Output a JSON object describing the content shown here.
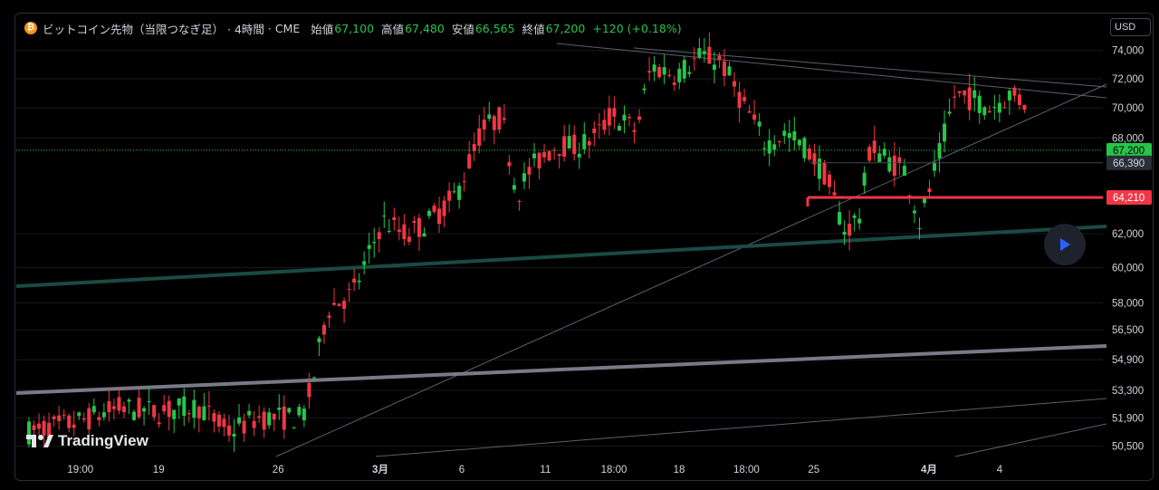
{
  "legend": {
    "coin_icon": "bitcoin-icon",
    "symbol": "ビットコイン先物（当限つなぎ足）",
    "timeframe": "· 4時間",
    "exchange": "· CME",
    "open_label": "始値",
    "open_value": "67,100",
    "high_label": "高値",
    "high_value": "67,480",
    "low_label": "安値",
    "low_value": "66,565",
    "close_label": "終値",
    "close_value": "67,200",
    "change": "+120 (+0.18%)"
  },
  "currency": "USD",
  "brand": "TradingView",
  "colors": {
    "up": "#26c64b",
    "down": "#f23645",
    "accent": "#2962ff"
  },
  "chart_data": {
    "type": "candlestick",
    "ylim": [
      50000,
      74500
    ],
    "y_scale": "log",
    "grid": true,
    "y_ticks": [
      {
        "value": 74000,
        "label": "74,000"
      },
      {
        "value": 72000,
        "label": "72,000"
      },
      {
        "value": 70000,
        "label": "70,000"
      },
      {
        "value": 68000,
        "label": "68,000"
      },
      {
        "value": 62000,
        "label": "62,000"
      },
      {
        "value": 60000,
        "label": "60,000"
      },
      {
        "value": 58000,
        "label": "58,000"
      },
      {
        "value": 56500,
        "label": "56,500"
      },
      {
        "value": 54900,
        "label": "54,900"
      },
      {
        "value": 53300,
        "label": "53,300"
      },
      {
        "value": 51900,
        "label": "51,900"
      },
      {
        "value": 50500,
        "label": "50,500"
      }
    ],
    "x_ticks": [
      {
        "pos": 0.059,
        "label": "19:00",
        "bold": false
      },
      {
        "pos": 0.131,
        "label": "19",
        "bold": false
      },
      {
        "pos": 0.241,
        "label": "26",
        "bold": false
      },
      {
        "pos": 0.335,
        "label": "3月",
        "bold": true
      },
      {
        "pos": 0.41,
        "label": "6",
        "bold": false
      },
      {
        "pos": 0.487,
        "label": "11",
        "bold": false
      },
      {
        "pos": 0.55,
        "label": "18:00",
        "bold": false
      },
      {
        "pos": 0.61,
        "label": "18",
        "bold": false
      },
      {
        "pos": 0.672,
        "label": "18:00",
        "bold": false
      },
      {
        "pos": 0.734,
        "label": "25",
        "bold": false
      },
      {
        "pos": 0.84,
        "label": "4月",
        "bold": true
      },
      {
        "pos": 0.905,
        "label": "4",
        "bold": false
      }
    ],
    "price_labels": [
      {
        "value": 67200,
        "label": "67,200",
        "kind": "last"
      },
      {
        "value": 66390,
        "label": "66,390",
        "kind": "line"
      },
      {
        "value": 64210,
        "label": "64,210",
        "kind": "alert"
      }
    ],
    "anchors": [
      [
        0,
        51200
      ],
      [
        0.05,
        51700
      ],
      [
        0.09,
        52400
      ],
      [
        0.13,
        52200
      ],
      [
        0.17,
        52500
      ],
      [
        0.2,
        51200
      ],
      [
        0.23,
        51900
      ],
      [
        0.275,
        51900
      ],
      [
        0.285,
        53700
      ],
      [
        0.3,
        57700
      ],
      [
        0.325,
        58500
      ],
      [
        0.34,
        60500
      ],
      [
        0.355,
        62800
      ],
      [
        0.38,
        61900
      ],
      [
        0.405,
        62900
      ],
      [
        0.43,
        64400
      ],
      [
        0.455,
        68600
      ],
      [
        0.475,
        69400
      ],
      [
        0.49,
        64400
      ],
      [
        0.505,
        66100
      ],
      [
        0.53,
        67600
      ],
      [
        0.55,
        67400
      ],
      [
        0.57,
        68100
      ],
      [
        0.585,
        69600
      ],
      [
        0.61,
        68500
      ],
      [
        0.625,
        72900
      ],
      [
        0.65,
        72300
      ],
      [
        0.675,
        73600
      ],
      [
        0.695,
        73200
      ],
      [
        0.715,
        70600
      ],
      [
        0.74,
        67600
      ],
      [
        0.76,
        68300
      ],
      [
        0.78,
        67400
      ],
      [
        0.8,
        65600
      ],
      [
        0.82,
        62100
      ],
      [
        0.835,
        63200
      ],
      [
        0.845,
        67500
      ],
      [
        0.865,
        66500
      ],
      [
        0.88,
        65900
      ],
      [
        0.895,
        62600
      ],
      [
        0.915,
        67000
      ],
      [
        0.93,
        70900
      ],
      [
        0.95,
        70600
      ],
      [
        0.965,
        70000
      ],
      [
        0.985,
        70900
      ],
      [
        1.0,
        70400
      ]
    ]
  }
}
